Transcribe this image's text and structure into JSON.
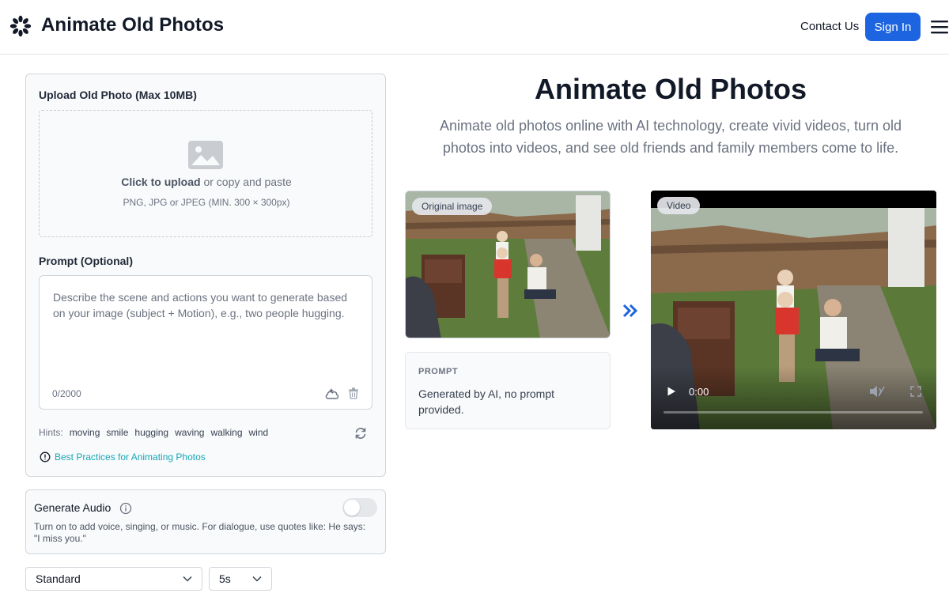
{
  "header": {
    "brand": "Animate Old Photos",
    "contact_label": "Contact Us",
    "signin_label": "Sign In"
  },
  "upload": {
    "label": "Upload Old Photo (Max 10MB)",
    "click_text": "Click to upload",
    "rest_text": " or copy and paste",
    "hint": "PNG, JPG or JPEG (MIN. 300 × 300px)"
  },
  "prompt": {
    "label": "Prompt (Optional)",
    "placeholder": "Describe the scene and actions you want to generate based on your image (subject + Motion), e.g., two people hugging.",
    "value": "",
    "count": "0/2000"
  },
  "hints": {
    "label": "Hints:",
    "items": [
      "moving",
      "smile",
      "hugging",
      "waving",
      "walking",
      "wind"
    ]
  },
  "best_practices_label": "Best Practices for Animating Photos",
  "audio": {
    "title": "Generate Audio",
    "enabled": false,
    "description": "Turn on to add voice, singing, or music. For dialogue, use quotes like: He says: \"I miss you.\""
  },
  "settings": {
    "quality": "Standard",
    "duration": "5s"
  },
  "hero": {
    "title": "Animate Old Photos",
    "subtitle": "Animate old photos online with AI technology, create vivid videos, turn old photos into videos, and see old friends and family members come to life."
  },
  "example": {
    "original_badge": "Original image",
    "prompt_title": "PROMPT",
    "prompt_text": "Generated by AI, no prompt provided.",
    "video_badge": "Video",
    "video_time": "0:00"
  },
  "colors": {
    "accent": "#1d64e0",
    "link": "#14a8b8"
  }
}
